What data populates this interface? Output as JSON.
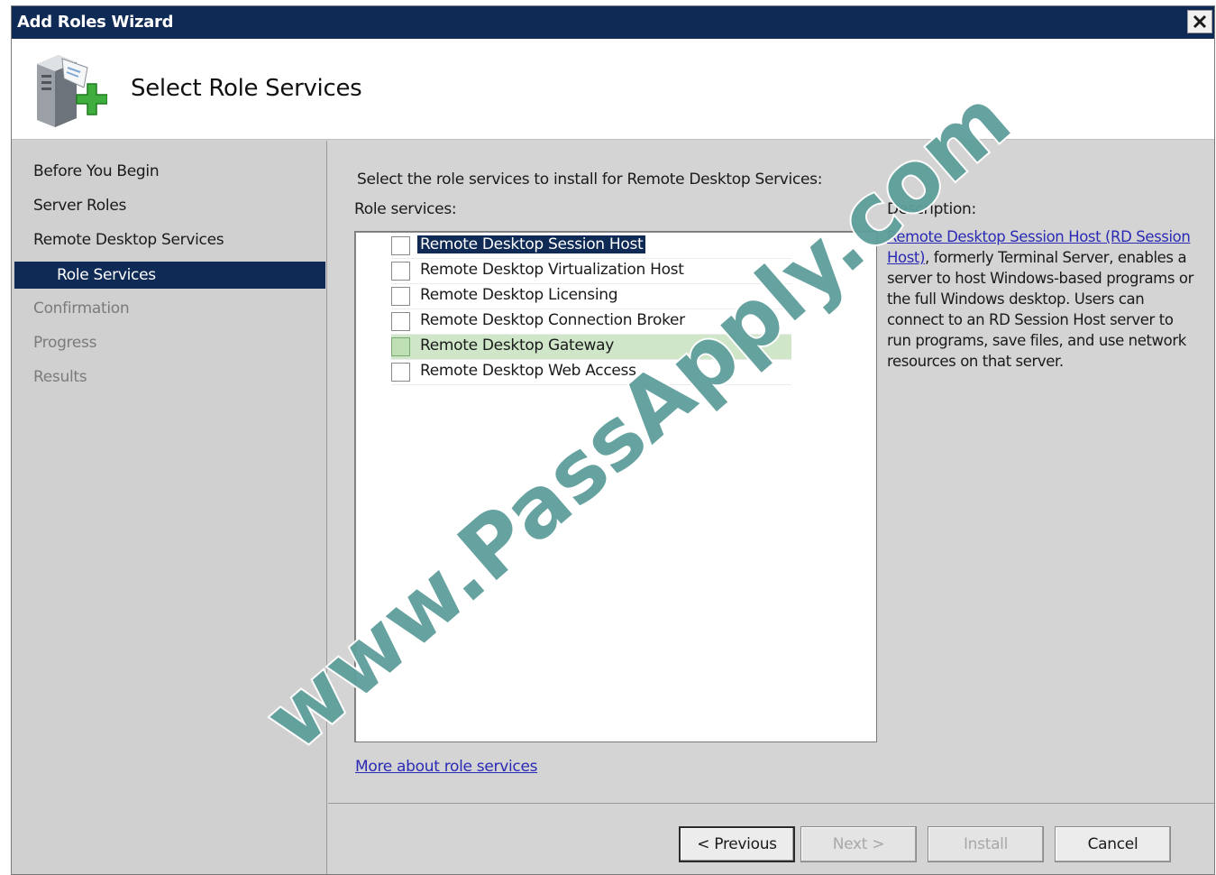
{
  "window": {
    "title": "Add Roles Wizard"
  },
  "header": {
    "title": "Select Role Services"
  },
  "sidebar": {
    "items": [
      {
        "label": "Before You Begin",
        "state": "normal"
      },
      {
        "label": "Server Roles",
        "state": "normal"
      },
      {
        "label": "Remote Desktop Services",
        "state": "normal"
      },
      {
        "label": "Role Services",
        "state": "active"
      },
      {
        "label": "Confirmation",
        "state": "disabled"
      },
      {
        "label": "Progress",
        "state": "disabled"
      },
      {
        "label": "Results",
        "state": "disabled"
      }
    ]
  },
  "main": {
    "instruction": "Select the role services to install for Remote Desktop Services:",
    "role_services_label": "Role services:",
    "role_services": [
      {
        "label": "Remote Desktop Session Host",
        "checked": false,
        "selected": true
      },
      {
        "label": "Remote Desktop Virtualization Host",
        "checked": false,
        "selected": false
      },
      {
        "label": "Remote Desktop Licensing",
        "checked": false,
        "selected": false
      },
      {
        "label": "Remote Desktop Connection Broker",
        "checked": false,
        "selected": false
      },
      {
        "label": "Remote Desktop Gateway",
        "checked": false,
        "selected": false
      },
      {
        "label": "Remote Desktop Web Access",
        "checked": false,
        "selected": false
      }
    ],
    "more_link": "More about role services",
    "description_label": "Description:",
    "description_link": "Remote Desktop Session Host (RD Session Host)",
    "description_text": ", formerly Terminal Server, enables a server to host Windows-based programs or the full Windows desktop. Users can connect to an RD Session Host server to run programs, save files, and use network resources on that server."
  },
  "footer": {
    "previous": "< Previous",
    "next": "Next >",
    "install": "Install",
    "cancel": "Cancel"
  },
  "watermark": {
    "text": "www.PassApply.com"
  },
  "colors": {
    "title_bar": "#0e2a55",
    "selection": "#0e2a55",
    "link": "#2a2ab5",
    "gateway_highlight": "#cfe6c9",
    "watermark_fill": "#5e9f9b"
  }
}
